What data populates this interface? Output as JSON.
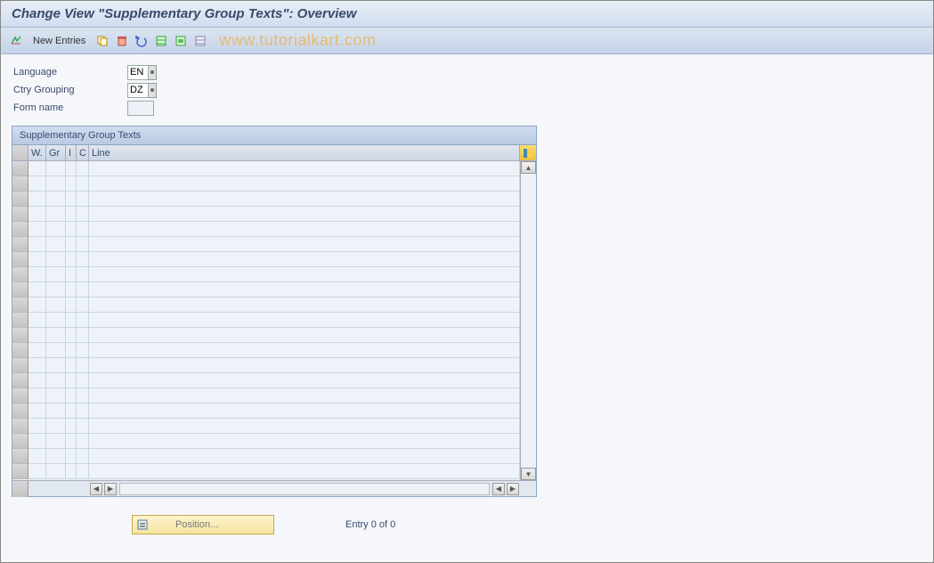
{
  "title": "Change View \"Supplementary Group Texts\": Overview",
  "toolbar": {
    "new_entries": "New Entries"
  },
  "watermark": "www.tutorialkart.com",
  "form": {
    "language_label": "Language",
    "language_value": "EN",
    "ctry_label": "Ctry Grouping",
    "ctry_value": "DZ",
    "formname_label": "Form name",
    "formname_value": ""
  },
  "grid": {
    "title": "Supplementary Group Texts",
    "columns": {
      "w": "W.",
      "gr": "Gr",
      "i": "I",
      "c": "C",
      "line": "Line"
    }
  },
  "footer": {
    "position": "Position...",
    "entry": "Entry 0 of 0"
  }
}
